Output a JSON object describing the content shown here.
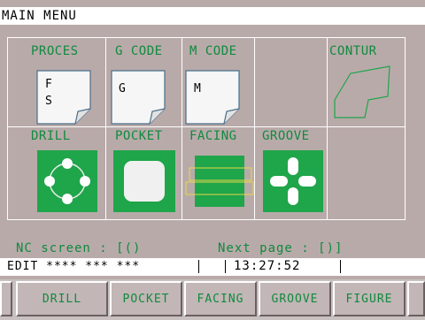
{
  "title": "MAIN MENU",
  "menu": {
    "row1": [
      {
        "label": "PROCES",
        "icon": "document-icon",
        "lines": [
          "F",
          "S"
        ]
      },
      {
        "label": "G CODE",
        "icon": "document-icon",
        "lines": [
          "G"
        ]
      },
      {
        "label": "M CODE",
        "icon": "document-icon",
        "lines": [
          "M"
        ]
      },
      {
        "label": ""
      },
      {
        "label": "CONTUR",
        "icon": "contour-icon"
      }
    ],
    "row2": [
      {
        "label": "DRILL",
        "icon": "drill-pattern-icon"
      },
      {
        "label": "POCKET",
        "icon": "pocket-icon"
      },
      {
        "label": "FACING",
        "icon": "facing-icon"
      },
      {
        "label": "GROOVE",
        "icon": "groove-icon"
      },
      {
        "label": ""
      }
    ]
  },
  "status": {
    "nc_screen": "NC screen : [()",
    "next_page": "Next page : [)]"
  },
  "info": {
    "mode": "EDIT **** *** ***",
    "time": "13:27:52"
  },
  "softkeys": [
    "DRILL",
    "POCKET",
    "FACING",
    "GROOVE",
    "FIGURE"
  ],
  "colors": {
    "background": "#b9aaaa",
    "label_green": "#0f8a3d",
    "tile_green": "#1fa54a",
    "outline_yellow": "#e6d84a"
  }
}
